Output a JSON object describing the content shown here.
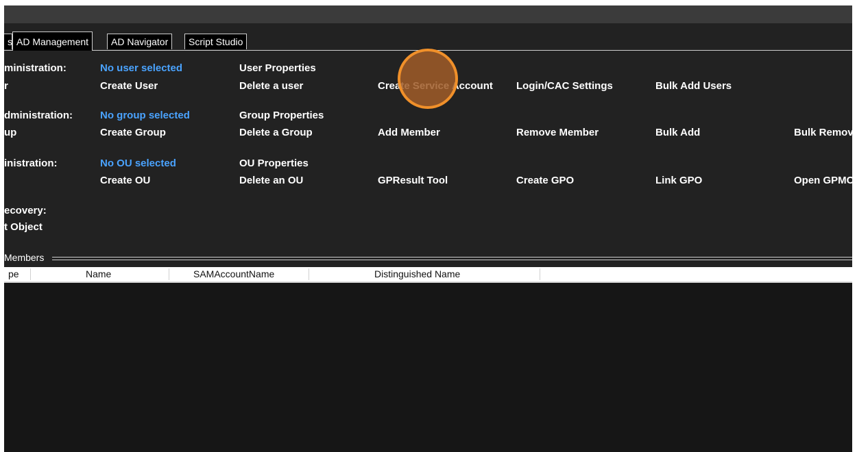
{
  "tabs": [
    "s",
    "AD Management",
    "AD Navigator",
    "Script Studio"
  ],
  "rows": {
    "user": {
      "section": "ministration:",
      "sub": "r",
      "status": "No user selected",
      "properties": "User Properties",
      "actions": [
        "Create User",
        "Delete a user",
        "Create Service Account",
        "Login/CAC Settings",
        "Bulk Add Users"
      ]
    },
    "group": {
      "section": "dministration:",
      "sub": "up",
      "status": "No group selected",
      "properties": "Group Properties",
      "actions": [
        "Create Group",
        "Delete a Group",
        "Add Member",
        "Remove Member",
        "Bulk Add",
        "Bulk Remov"
      ]
    },
    "ou": {
      "section": "inistration:",
      "status": "No OU selected",
      "properties": "OU Properties",
      "actions": [
        "Create OU",
        "Delete an OU",
        "GPResult Tool",
        "Create GPO",
        "Link GPO",
        "Open GPMC"
      ]
    },
    "recovery": {
      "section": "ecovery:",
      "action": "t Object"
    }
  },
  "members": {
    "caption": "Members",
    "columns": [
      "pe",
      "Name",
      "SAMAccountName",
      "Distinguished Name"
    ]
  },
  "colors": {
    "background": "#222222",
    "titlebar": "#3b3b3b",
    "status_link": "#4aa3ff",
    "cursor_highlight": "#f0902a"
  }
}
